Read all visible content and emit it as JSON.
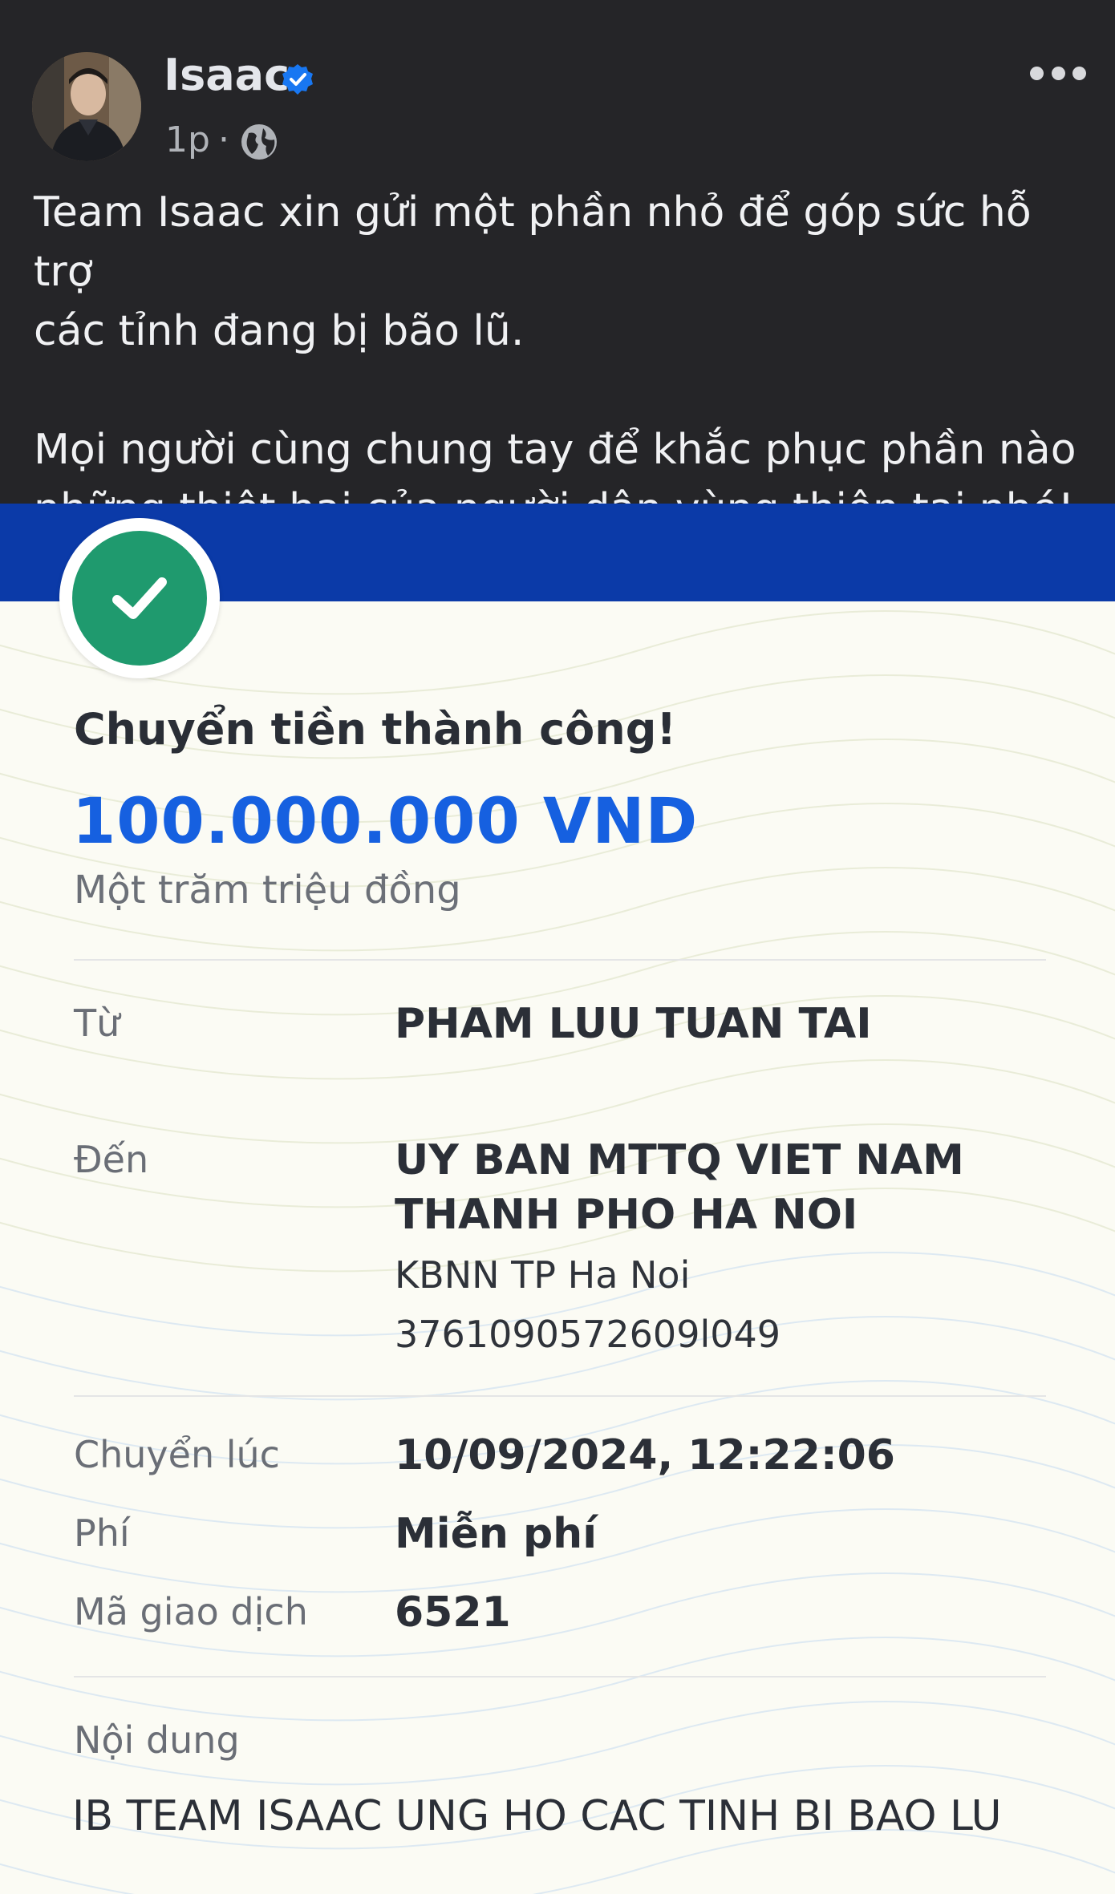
{
  "post": {
    "author": "Isaac",
    "time": "1p",
    "separator": "·",
    "paragraph1": "Team Isaac xin gửi một phần nhỏ để góp sức hỗ trợ\ncác tỉnh đang bị bão lũ.",
    "paragraph2": "Mọi người cùng chung tay để khắc phục phần nào\nnhững thiệt hại của người dân  vùng thiên tai nhé!",
    "icons": {
      "verified": "verified-badge-icon",
      "audience": "globe-icon",
      "more": "more-options-icon"
    }
  },
  "receipt": {
    "title": "Chuyển tiền thành công!",
    "amount": "100.000.000 VND",
    "amount_words": "Một trăm triệu đồng",
    "from_label": "Từ",
    "from_value": "PHAM LUU TUAN TAI",
    "to_label": "Đến",
    "to_name_line1": "UY BAN MTTQ VIET NAM",
    "to_name_line2": "THANH PHO HA NOI",
    "to_bank": "KBNN TP Ha Noi",
    "to_account": "3761090572609l049",
    "time_label": "Chuyển lúc",
    "time_value": "10/09/2024, 12:22:06",
    "fee_label": "Phí",
    "fee_value": "Miễn phí",
    "txn_label": "Mã giao dịch",
    "txn_value": "6521",
    "content_label": "Nội dung",
    "content_value": "IB TEAM ISAAC UNG HO CAC TINH BI BAO LU",
    "icons": {
      "success": "check-circle-icon"
    }
  },
  "colors": {
    "post_bg": "#252528",
    "band_blue": "#0b3aa8",
    "success_green": "#1f9a6e",
    "amount_blue": "#1660e0",
    "verified_blue": "#1877f2"
  }
}
